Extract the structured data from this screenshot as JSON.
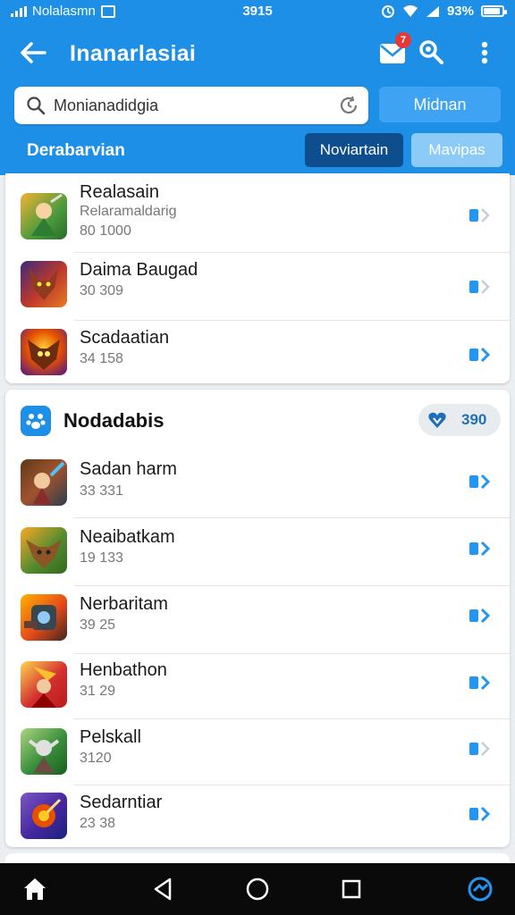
{
  "status_bar": {
    "carrier": "Nolalasmn",
    "time": "3915",
    "battery_text": "93%"
  },
  "app_bar": {
    "title": "Inanarlasiai",
    "mail_badge": "7"
  },
  "search": {
    "value": "Monianadidgia",
    "button_label": "Midnan"
  },
  "filter": {
    "label": "Derabarvian",
    "chip_active": "Noviartain",
    "chip_inactive": "Mavipas"
  },
  "list_top": [
    {
      "name": "Realasain",
      "subtitle": "Relaramaldarig",
      "meta": "80 1000",
      "thumb": "green-warrior"
    },
    {
      "name": "Daima Baugad",
      "subtitle": "",
      "meta": "30 309",
      "thumb": "horned-demon"
    },
    {
      "name": "Scadaatian",
      "subtitle": "",
      "meta": "34 158",
      "thumb": "fire-beast"
    }
  ],
  "section": {
    "title": "Nodadabis",
    "badge_value": "390"
  },
  "list_section": [
    {
      "name": "Sadan harm",
      "meta": "33 331",
      "thumb": "sword-hero"
    },
    {
      "name": "Neaibatkam",
      "meta": "19 133",
      "thumb": "forest-elf"
    },
    {
      "name": "Nerbaritam",
      "meta": "39 25",
      "thumb": "armored-knight"
    },
    {
      "name": "Henbathon",
      "meta": "31 29",
      "thumb": "red-wizard"
    },
    {
      "name": "Pelskall",
      "meta": "3120",
      "thumb": "goblin"
    },
    {
      "name": "Sedarntiar",
      "meta": "23 38",
      "thumb": "flame-orb"
    }
  ],
  "colors": {
    "primary": "#1e8fe6",
    "primary_dark": "#0f4e8e",
    "chip_light": "#8ccbf8",
    "arrow": "#2196f3"
  }
}
